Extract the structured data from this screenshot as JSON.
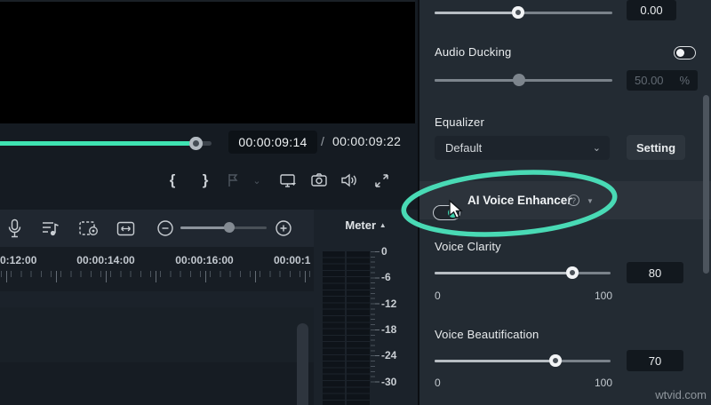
{
  "player": {
    "current_time": "00:00:09:14",
    "separator": "/",
    "total_time": "00:00:09:22",
    "brace_open": "{",
    "brace_close": "}",
    "marker_chevron": "⌄"
  },
  "timeline": {
    "ruler_labels": [
      "0:12:00",
      "00:00:14:00",
      "00:00:16:00",
      "00:00:1"
    ],
    "meter": {
      "label": "Meter",
      "collapse_arrow": "▲",
      "scale": [
        "0",
        "-6",
        "-12",
        "-18",
        "-24",
        "-30"
      ]
    }
  },
  "panel": {
    "top_slider": {
      "value": "0.00"
    },
    "audio_ducking": {
      "label": "Audio Ducking",
      "value": "50.00",
      "unit": "%"
    },
    "equalizer": {
      "label": "Equalizer",
      "preset": "Default",
      "chevron": "⌄",
      "setting_button": "Setting"
    },
    "ai_voice_enhancer": {
      "label": "AI Voice Enhancer",
      "help": "?",
      "caret": "▼"
    },
    "voice_clarity": {
      "label": "Voice Clarity",
      "value": "80",
      "min": "0",
      "max": "100"
    },
    "voice_beautification": {
      "label": "Voice Beautification",
      "value": "70",
      "min": "0",
      "max": "100"
    }
  },
  "watermark": "wtvid.com",
  "colors": {
    "accent_teal": "#3fe3b2",
    "annotation_teal": "#49dab5",
    "panel_bg": "#232b33",
    "highlight_row": "#2c333b"
  }
}
